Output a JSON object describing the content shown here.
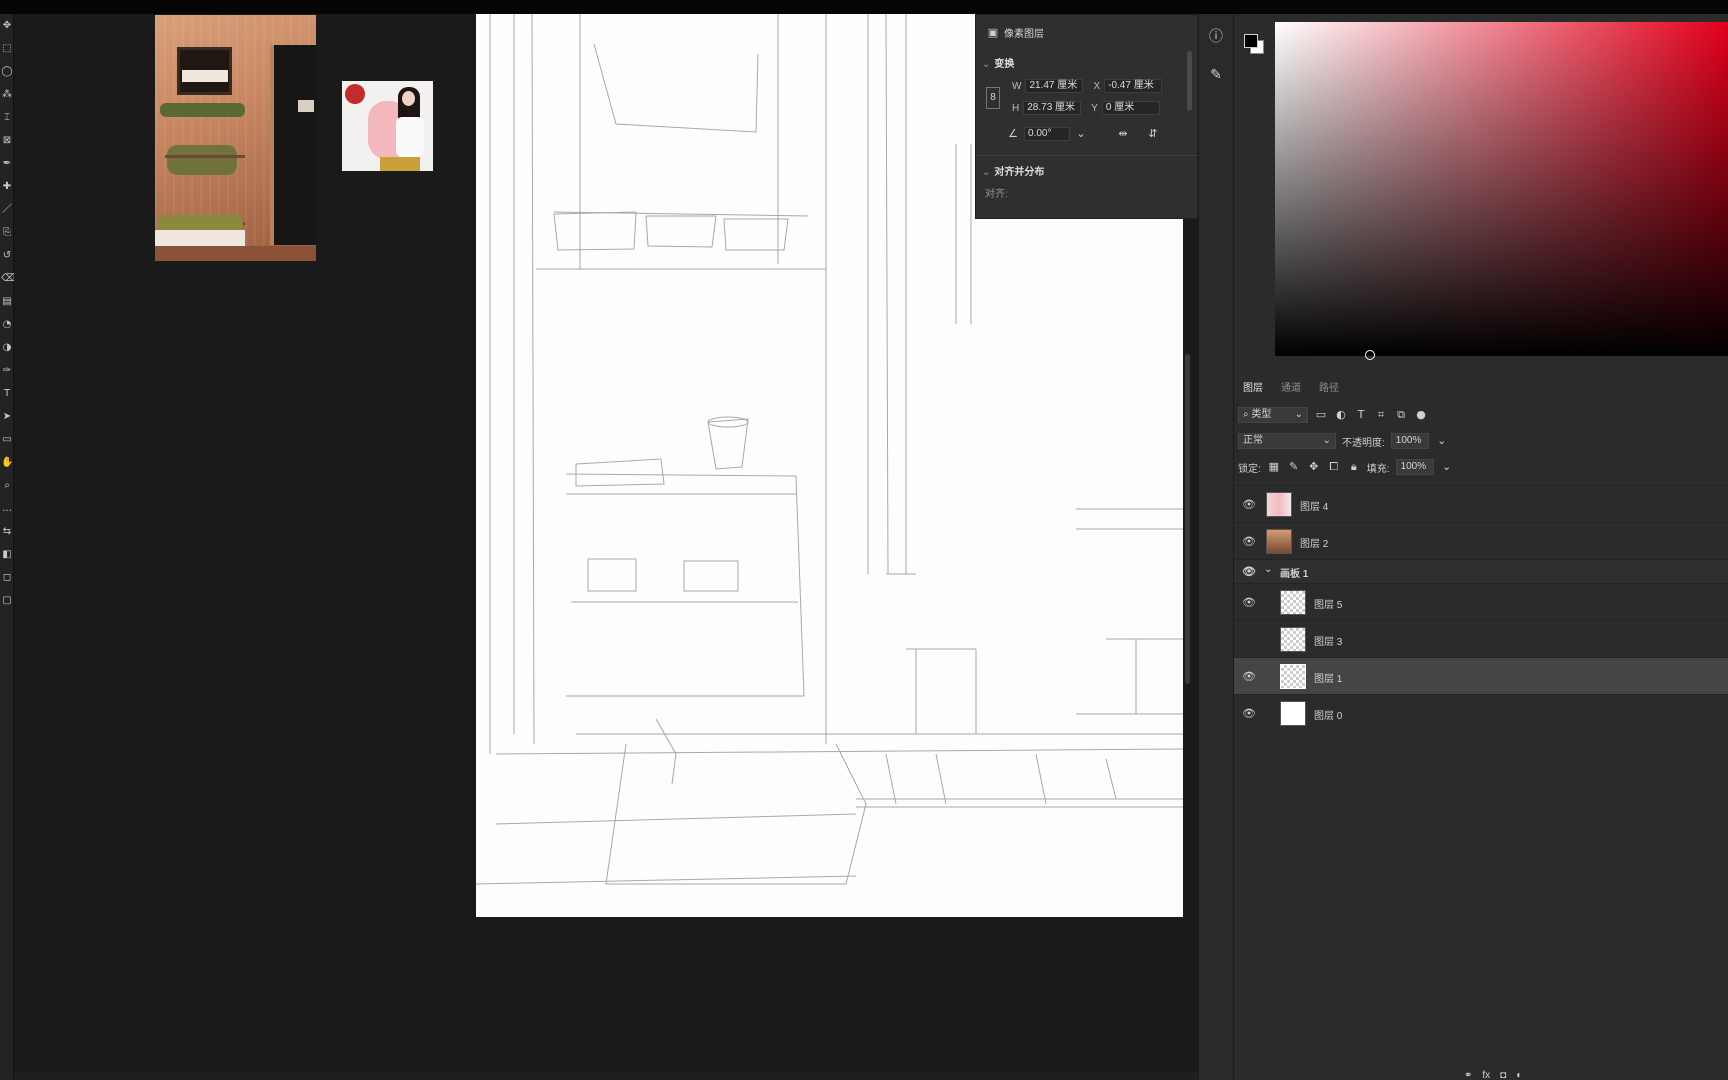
{
  "tools": [
    "move-tool",
    "marquee-tool",
    "lasso-tool",
    "magic-wand-tool",
    "crop-tool",
    "frame-tool",
    "eyedropper-tool",
    "healing-brush-tool",
    "brush-tool",
    "clone-stamp-tool",
    "history-brush-tool",
    "eraser-tool",
    "gradient-tool",
    "blur-tool",
    "dodge-tool",
    "pen-tool",
    "type-tool",
    "path-selection-tool",
    "shape-tool",
    "hand-tool",
    "zoom-tool",
    "more-tools",
    "swap-colors",
    "foreground-background-swatch",
    "quick-mask",
    "screen-mode"
  ],
  "properties": {
    "title": "像素图层",
    "transform_section": "变换",
    "w_label": "W",
    "w_value": "21.47 厘米",
    "x_label": "X",
    "x_value": "-0.47 厘米",
    "h_label": "H",
    "h_value": "28.73 厘米",
    "y_label": "Y",
    "y_value": "0 厘米",
    "angle_value": "0.00°",
    "align_section": "对齐并分布",
    "align_sub": "对齐:"
  },
  "side_icons": [
    "info-icon",
    "brush-settings-icon"
  ],
  "layers_panel": {
    "tabs": [
      "图层",
      "通道",
      "路径"
    ],
    "filter_label": "类型",
    "blend_mode": "正常",
    "opacity_label": "不透明度:",
    "opacity_value": "100%",
    "lock_label": "锁定:",
    "fill_label": "填充:",
    "fill_value": "100%",
    "layers": [
      {
        "name": "图层 4",
        "visible": true,
        "thumb": "photo4",
        "kind": "layer"
      },
      {
        "name": "图层 2",
        "visible": true,
        "thumb": "photo2",
        "kind": "layer"
      },
      {
        "name": "画板 1",
        "visible": true,
        "thumb": "",
        "kind": "artboard"
      },
      {
        "name": "图层 5",
        "visible": true,
        "thumb": "checker",
        "kind": "child"
      },
      {
        "name": "图层 3",
        "visible": false,
        "thumb": "checker",
        "kind": "child"
      },
      {
        "name": "图层 1",
        "visible": true,
        "thumb": "checker",
        "kind": "child",
        "selected": true
      },
      {
        "name": "图层 0",
        "visible": true,
        "thumb": "white",
        "kind": "child"
      }
    ]
  },
  "colors": {
    "foreground": "#000000",
    "background": "#ffffff",
    "picker_hue": "#e3001b"
  }
}
